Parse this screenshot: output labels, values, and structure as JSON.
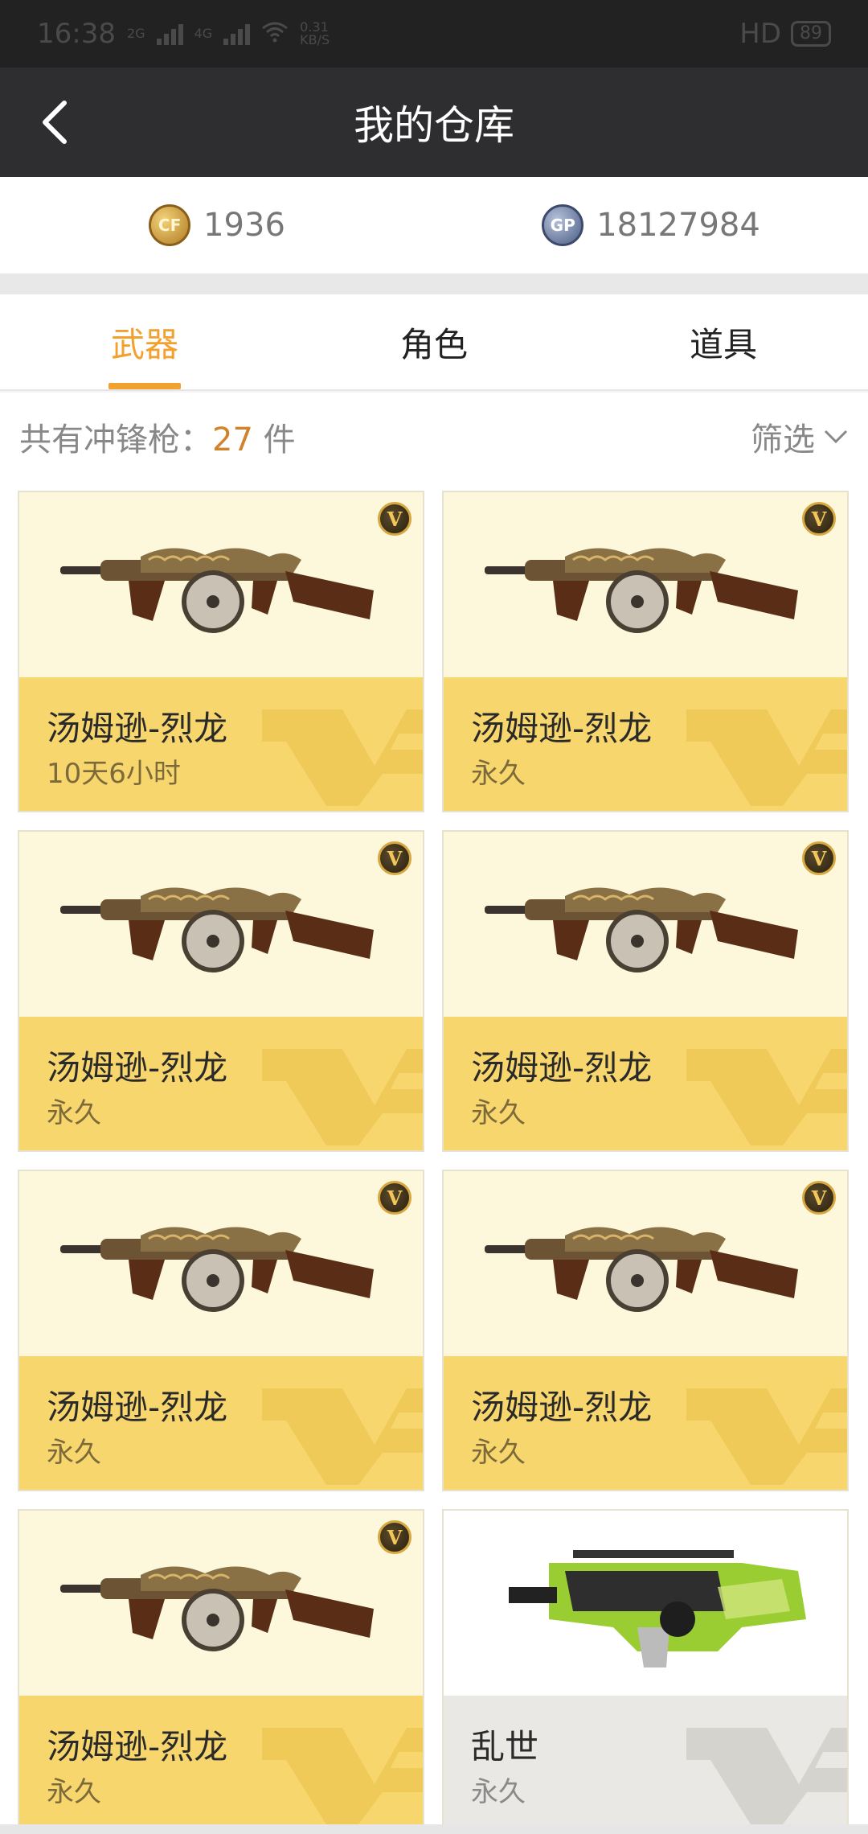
{
  "status_bar": {
    "time": "16:38",
    "net1": "2G",
    "net2": "4G",
    "speed": "0.31",
    "speed_unit": "KB/S",
    "hd": "HD",
    "battery": "89"
  },
  "header": {
    "title": "我的仓库",
    "back_icon": "chevron-left-icon"
  },
  "currency": [
    {
      "icon": "cf-coin-icon",
      "value": "1936"
    },
    {
      "icon": "gp-coin-icon",
      "value": "18127984"
    }
  ],
  "tabs": [
    {
      "label": "武器",
      "active": true
    },
    {
      "label": "角色",
      "active": false
    },
    {
      "label": "道具",
      "active": false
    }
  ],
  "summary": {
    "prefix": "共有冲锋枪：",
    "count": "27",
    "suffix": "件",
    "filter_label": "筛选"
  },
  "items": [
    {
      "name": "汤姆逊-烈龙",
      "duration": "10天6小时",
      "vip": true,
      "style": "gold"
    },
    {
      "name": "汤姆逊-烈龙",
      "duration": "永久",
      "vip": true,
      "style": "gold"
    },
    {
      "name": "汤姆逊-烈龙",
      "duration": "永久",
      "vip": true,
      "style": "gold"
    },
    {
      "name": "汤姆逊-烈龙",
      "duration": "永久",
      "vip": true,
      "style": "gold"
    },
    {
      "name": "汤姆逊-烈龙",
      "duration": "永久",
      "vip": true,
      "style": "gold"
    },
    {
      "name": "汤姆逊-烈龙",
      "duration": "永久",
      "vip": true,
      "style": "gold"
    },
    {
      "name": "汤姆逊-烈龙",
      "duration": "永久",
      "vip": true,
      "style": "gold"
    },
    {
      "name": "乱世",
      "duration": "永久",
      "vip": false,
      "style": "gray"
    }
  ],
  "colors": {
    "accent": "#f2a12e",
    "card_gold": "#f8d66e",
    "header_bg": "#2e2e30"
  }
}
